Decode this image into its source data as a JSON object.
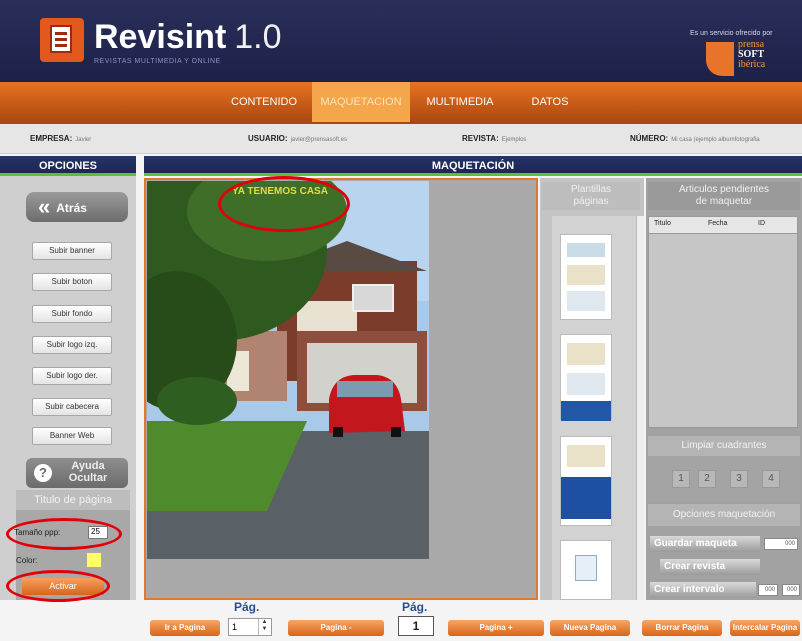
{
  "brand": {
    "name": "Revisint",
    "version": "1.0",
    "tagline": "REVISTAS MULTIMEDIA Y ONLINE",
    "servicio": "Es un servicio ofrecido por",
    "partner": [
      "prensa",
      "SOFT",
      "ibérica"
    ]
  },
  "nav": {
    "tabs": [
      "CONTENIDO",
      "MAQUETACION",
      "MULTIMEDIA",
      "DATOS"
    ],
    "active": "MAQUETACION"
  },
  "info": {
    "empresa_label": "EMPRESA:",
    "empresa_value": "Javier",
    "usuario_label": "USUARIO:",
    "usuario_value": "javier@prensasoft.es",
    "revista_label": "REVISTA:",
    "revista_value": "Ejemplos",
    "numero_label": "NÚMERO:",
    "numero_value": "Mi casa (ejemplo albumfotografia"
  },
  "left": {
    "heading": "OPCIONES",
    "back": "Atrás",
    "buttons": [
      "Subir banner",
      "Subir boton",
      "Subir fondo",
      "Subir logo izq.",
      "Subir logo der.",
      "Subir cabecera",
      "Banner Web"
    ],
    "ayuda": [
      "Ayuda",
      "Ocultar"
    ],
    "titulo_pagina": "Titulo de página",
    "tamano_label": "Tamaño ppp:",
    "tamano_value": "25",
    "color_label": "Color:",
    "activar": "Activar"
  },
  "main": {
    "heading": "MAQUETACIÓN",
    "photo_title": "YA TENEMOS CASA"
  },
  "templates": {
    "heading": [
      "Plantillas",
      "páginas"
    ]
  },
  "articles": {
    "heading": [
      "Articulos pendientes",
      "de maquetar"
    ],
    "columns": [
      "Titulo",
      "Fecha",
      "ID"
    ]
  },
  "limpiar": {
    "heading": "Limpiar cuadrantes",
    "buttons": [
      "1",
      "2",
      "3",
      "4"
    ]
  },
  "opciones": {
    "heading": "Opciones maquetación",
    "guardar": "Guardar maqueta",
    "guardar_value": "000",
    "crear_revista": "Crear revista",
    "crear_intervalo": "Crear intervalo",
    "intervalo_from": "000",
    "intervalo_to": "000"
  },
  "bottom": {
    "ir_pagina": "Ir a Pagina",
    "pag_label": "Pág.",
    "page_input": "1",
    "pagina_prev": "Pagina -",
    "current_page": "1",
    "pagina_next": "Pagina +",
    "nueva": "Nueva Pagina",
    "borrar": "Borrar Pagina",
    "intercalar": "Intercalar Pagina"
  },
  "colors": {
    "accent": "#e8731f",
    "navy": "#253566",
    "green": "#5bbf3a",
    "highlight": "#e0000a"
  }
}
